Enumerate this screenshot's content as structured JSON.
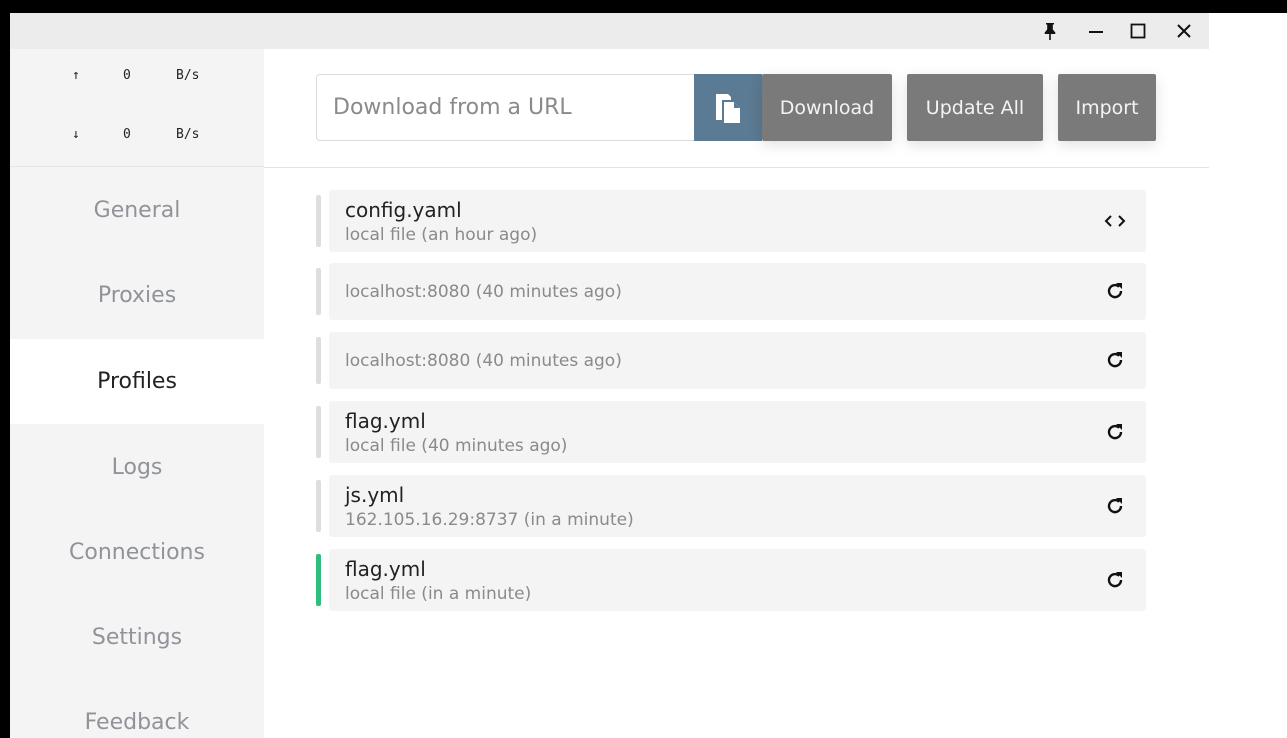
{
  "titlebar": {
    "icons": [
      "pin-icon",
      "minimize-icon",
      "maximize-icon",
      "close-icon"
    ]
  },
  "traffic": {
    "up": {
      "arrow": "↑",
      "value": "0",
      "unit": "B/s"
    },
    "down": {
      "arrow": "↓",
      "value": "0",
      "unit": "B/s"
    }
  },
  "sidebar": {
    "items": [
      {
        "label": "General"
      },
      {
        "label": "Proxies"
      },
      {
        "label": "Profiles",
        "active": true
      },
      {
        "label": "Logs"
      },
      {
        "label": "Connections"
      },
      {
        "label": "Settings"
      },
      {
        "label": "Feedback"
      }
    ]
  },
  "toolbar": {
    "url_placeholder": "Download from a URL",
    "url_value": "",
    "paste_icon": "paste-icon",
    "download_label": "Download",
    "update_all_label": "Update All",
    "import_label": "Import"
  },
  "profiles": [
    {
      "name": "config.yaml",
      "sub": "local file (an hour ago)",
      "icon": "code-icon",
      "active": false
    },
    {
      "name": "",
      "sub": "localhost:8080 (40 minutes ago)",
      "icon": "refresh-icon",
      "active": false
    },
    {
      "name": "",
      "sub": "localhost:8080 (40 minutes ago)",
      "icon": "refresh-icon",
      "active": false
    },
    {
      "name": "flag.yml",
      "sub": "local file (40 minutes ago)",
      "icon": "refresh-icon",
      "active": false
    },
    {
      "name": "js.yml",
      "sub": "162.105.16.29:8737 (in a minute)",
      "icon": "refresh-icon",
      "active": false
    },
    {
      "name": "flag.yml",
      "sub": "local file (in a minute)",
      "icon": "refresh-icon",
      "active": true
    }
  ],
  "colors": {
    "active_bar": "#2fbd7c",
    "paste_button": "#5b7a93",
    "action_button": "#7a7a7a"
  }
}
